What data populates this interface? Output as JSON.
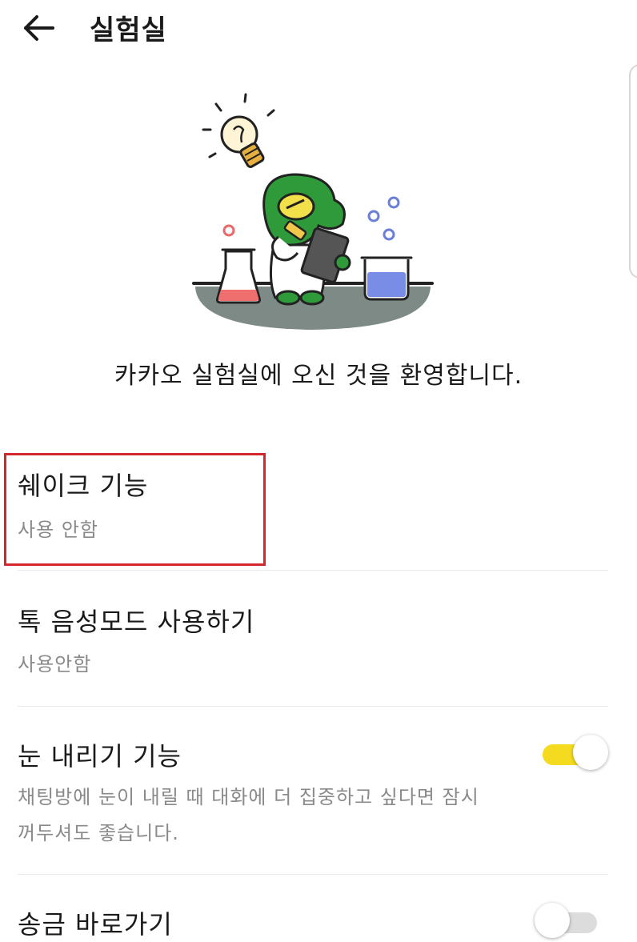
{
  "header": {
    "title": "실험실",
    "back_icon": "arrow-left-icon"
  },
  "hero": {
    "illustration": "kakao-lab-character-illustration",
    "welcome_text": "카카오 실험실에 오신 것을 환영합니다."
  },
  "settings": [
    {
      "title": "쉐이크 기능",
      "description": "사용 안함",
      "highlighted": true,
      "highlight_color": "#d6262d"
    },
    {
      "title": "톡 음성모드 사용하기",
      "description": "사용안함"
    },
    {
      "title": "눈 내리기 기능",
      "description_line1": "채팅방에 눈이 내릴 때 대화에 더 집중하고 싶다면 잠시",
      "description_line2": "꺼두셔도 좋습니다.",
      "toggle_on": true,
      "toggle_color": "#f5db1f"
    },
    {
      "title": "송금 바로가기",
      "toggle_on": false
    }
  ]
}
